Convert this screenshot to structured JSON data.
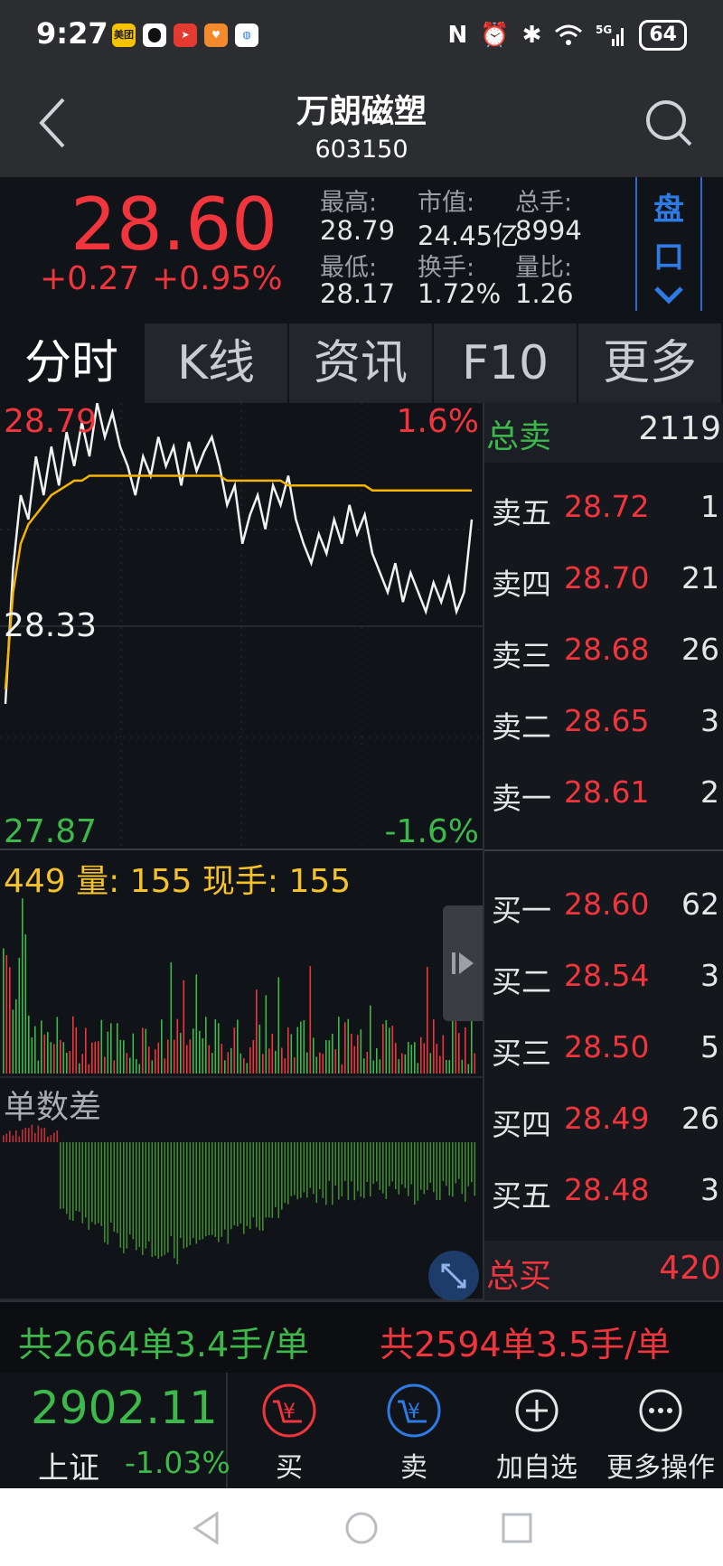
{
  "status_bar": {
    "time": "9:27",
    "app_icons": [
      "美团",
      "qq-icon",
      "app-red-icon",
      "app-orange-icon",
      "app-chat-icon"
    ],
    "battery": "64"
  },
  "header": {
    "title": "万朗磁塑",
    "code": "603150"
  },
  "quote": {
    "price": "28.60",
    "change": "+0.27",
    "change_pct": "+0.95%",
    "stats": {
      "high_label": "最高:",
      "high_value": "28.79",
      "mktcap_label": "市值:",
      "mktcap_value": "24.45亿",
      "total_label": "总手:",
      "total_value": "8994",
      "low_label": "最低:",
      "low_value": "28.17",
      "turnover_label": "换手:",
      "turnover_value": "1.72%",
      "ratio_label": "量比:",
      "ratio_value": "1.26"
    },
    "pankou_label_1": "盘",
    "pankou_label_2": "口"
  },
  "tabs": [
    "分时",
    "K线",
    "资讯",
    "F10",
    "更多"
  ],
  "chart": {
    "price_max": "28.79",
    "price_mid": "28.33",
    "price_min": "27.87",
    "pct_max": "1.6%",
    "pct_min": "-1.6%",
    "volume_info": "449 量: 155 现手: 155",
    "diff_label": "单数差"
  },
  "chart_data": {
    "type": "line",
    "y_range": [
      27.87,
      28.79
    ],
    "prev_close": 28.33,
    "series": [
      {
        "values": [
          28.17,
          28.45,
          28.6,
          28.55,
          28.68,
          28.6,
          28.7,
          28.62,
          28.73,
          28.66,
          28.75,
          28.68,
          28.79,
          28.72,
          28.77,
          28.7,
          28.66,
          28.6,
          28.68,
          28.64,
          28.72,
          28.66,
          28.7,
          28.62,
          28.71,
          28.65,
          28.69,
          28.72,
          28.66,
          28.58,
          28.62,
          28.5,
          28.56,
          28.6,
          28.53,
          28.62,
          28.58,
          28.64,
          28.55,
          28.5,
          28.46,
          28.52,
          28.48,
          28.55,
          28.5,
          28.58,
          28.52,
          28.56,
          28.48,
          28.44,
          28.4,
          28.46,
          28.38,
          28.44,
          28.4,
          28.36,
          28.42,
          28.38,
          28.43,
          28.36,
          28.4,
          28.55
        ]
      },
      {
        "values": [
          28.2,
          28.4,
          28.5,
          28.54,
          28.56,
          28.58,
          28.6,
          28.61,
          28.62,
          28.63,
          28.63,
          28.64,
          28.64,
          28.64,
          28.64,
          28.64,
          28.64,
          28.64,
          28.64,
          28.64,
          28.64,
          28.64,
          28.64,
          28.64,
          28.64,
          28.64,
          28.64,
          28.64,
          28.64,
          28.63,
          28.63,
          28.63,
          28.63,
          28.63,
          28.63,
          28.63,
          28.63,
          28.62,
          28.62,
          28.62,
          28.62,
          28.62,
          28.62,
          28.62,
          28.62,
          28.62,
          28.62,
          28.62,
          28.61,
          28.61,
          28.61,
          28.61,
          28.61,
          28.61,
          28.61,
          28.61,
          28.61,
          28.61,
          28.61,
          28.61,
          28.61,
          28.61
        ]
      }
    ]
  },
  "order_book": {
    "sell_total_label": "总卖",
    "sell_total_value": "2119",
    "sells": [
      {
        "label": "卖五",
        "price": "28.72",
        "qty": "1"
      },
      {
        "label": "卖四",
        "price": "28.70",
        "qty": "21"
      },
      {
        "label": "卖三",
        "price": "28.68",
        "qty": "26"
      },
      {
        "label": "卖二",
        "price": "28.65",
        "qty": "3"
      },
      {
        "label": "卖一",
        "price": "28.61",
        "qty": "2"
      }
    ],
    "buys": [
      {
        "label": "买一",
        "price": "28.60",
        "qty": "62"
      },
      {
        "label": "买二",
        "price": "28.54",
        "qty": "3"
      },
      {
        "label": "买三",
        "price": "28.50",
        "qty": "5"
      },
      {
        "label": "买四",
        "price": "28.49",
        "qty": "26"
      },
      {
        "label": "买五",
        "price": "28.48",
        "qty": "3"
      }
    ],
    "buy_total_label": "总买",
    "buy_total_value": "420"
  },
  "summary": {
    "left_text": "共2664单3.4手/单",
    "right_text": "共2594单3.5手/单"
  },
  "bottom_bar": {
    "index_value": "2902.11",
    "index_name": "上证",
    "index_pct": "-1.03%",
    "buy_label": "买",
    "sell_label": "卖",
    "watch_label": "加自选",
    "more_label": "更多操作"
  },
  "colors": {
    "up": "#f0353d",
    "down": "#3db84a",
    "avg_line": "#f5b400",
    "accent": "#2f7be5",
    "background": "#101318"
  }
}
